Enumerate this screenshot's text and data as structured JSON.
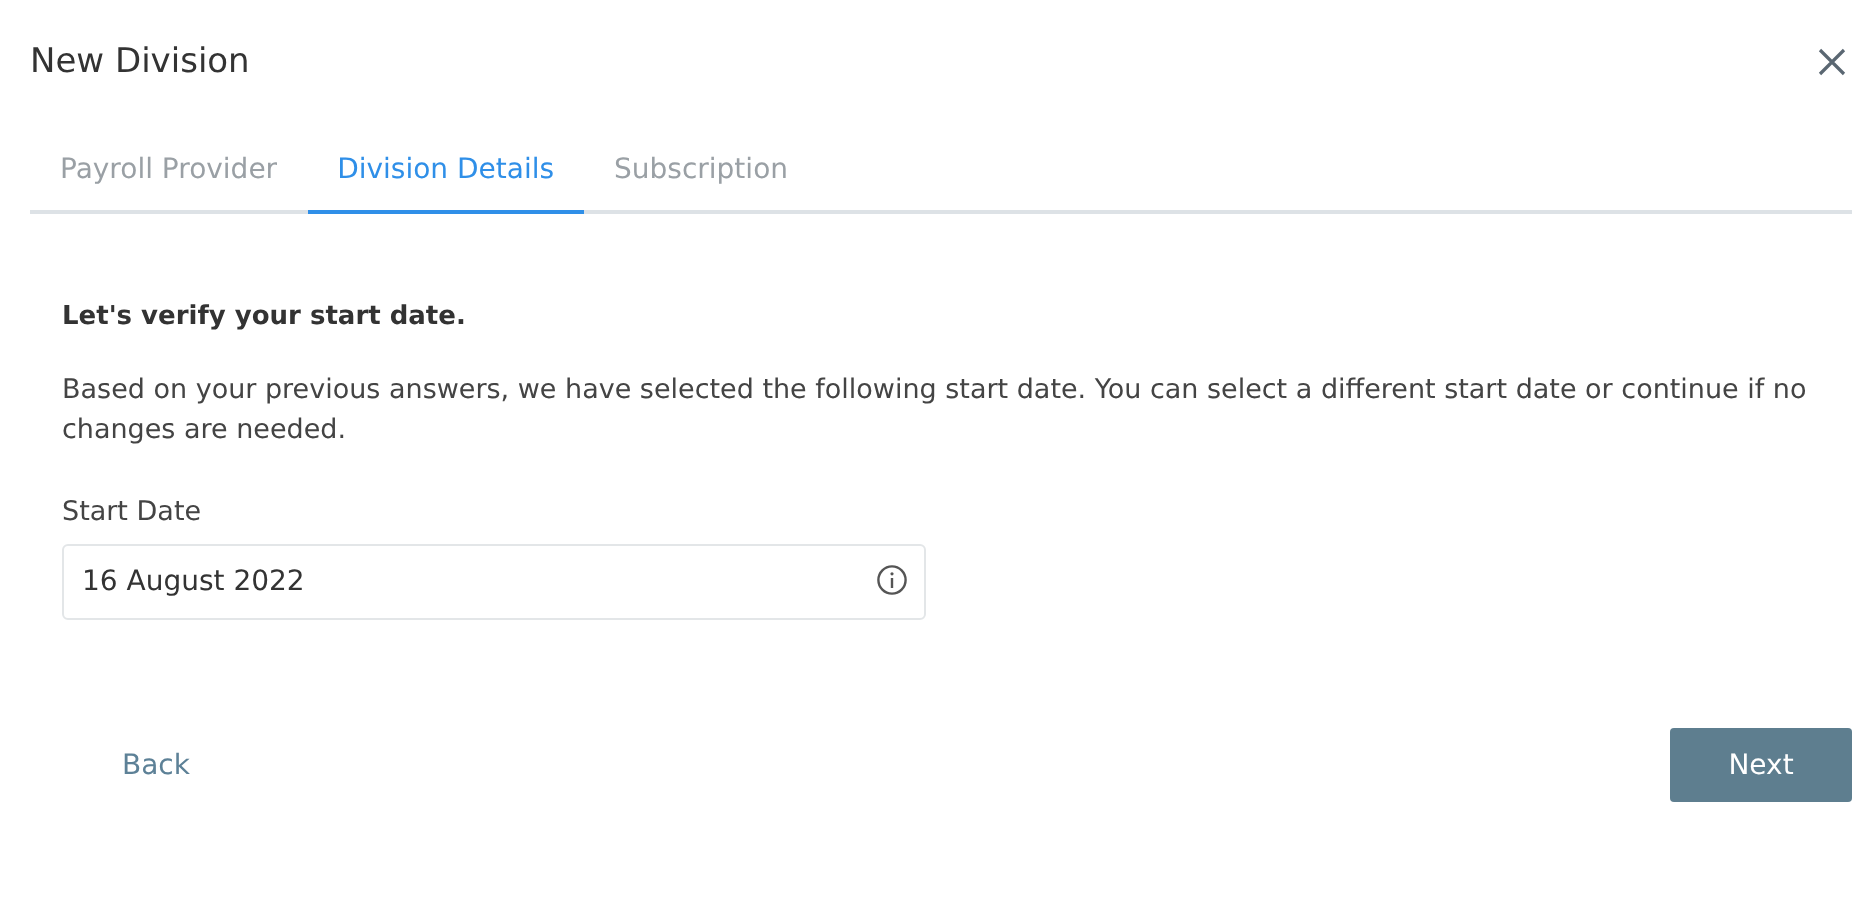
{
  "dialog": {
    "title": "New Division"
  },
  "tabs": [
    {
      "label": "Payroll Provider",
      "selected": false
    },
    {
      "label": "Division Details",
      "selected": true
    },
    {
      "label": "Subscription",
      "selected": false
    }
  ],
  "heading": "Let's verify your start date.",
  "description": "Based on your previous answers, we have selected the following start date. You can select a different start date or continue if no changes are needed.",
  "start_date": {
    "label": "Start Date",
    "value": "16 August 2022"
  },
  "buttons": {
    "back": "Back",
    "next": "Next"
  }
}
